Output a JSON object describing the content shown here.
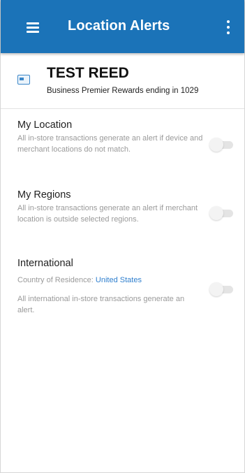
{
  "app_bar": {
    "title": "Location Alerts",
    "menu_icon": "hamburger-menu-icon",
    "overflow_icon": "more-vertical-icon",
    "background_color": "#1b73b8"
  },
  "account": {
    "icon": "card-icon",
    "name": "TEST REED",
    "description": "Business Premier Rewards ending in 1029"
  },
  "alerts": [
    {
      "title": "My Location",
      "description": "All in-store transactions generate an alert if device and merchant locations do not match.",
      "enabled": false
    },
    {
      "title": "My Regions",
      "description": "All in-store transactions generate an alert if merchant location is outside selected regions.",
      "enabled": false
    },
    {
      "title": "International",
      "country_label": "Country of Residence:",
      "country_value": "United States",
      "description": "All international in-store transactions generate an alert.",
      "enabled": false
    }
  ],
  "colors": {
    "link": "#2f7fce",
    "toggle_off": "#e4e4e4"
  }
}
